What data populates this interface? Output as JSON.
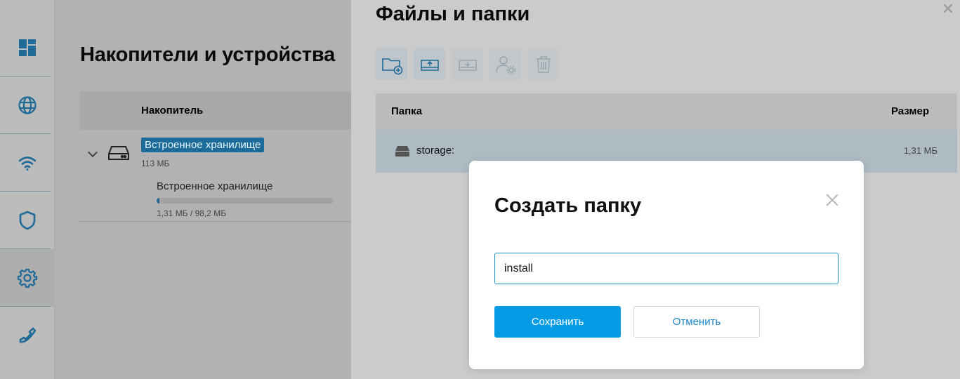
{
  "sidebar": {
    "items": [
      {
        "name": "dashboard",
        "icon": "dashboard-icon"
      },
      {
        "name": "internet",
        "icon": "globe-icon"
      },
      {
        "name": "wifi",
        "icon": "wifi-icon"
      },
      {
        "name": "security",
        "icon": "shield-icon"
      },
      {
        "name": "settings",
        "icon": "gear-icon",
        "active": true
      },
      {
        "name": "phone",
        "icon": "phone-icon"
      }
    ],
    "icon_color": "#1f6a96"
  },
  "background_page": {
    "title": "Накопители и устройства",
    "table_header": "Накопитель",
    "storage": {
      "name": "Встроенное хранилище",
      "size": "113 МБ",
      "partition_name": "Встроенное хранилище",
      "usage_text": "1,31 МБ / 98,2 МБ",
      "usage_fraction": 0.0133
    }
  },
  "file_panel": {
    "title": "Файлы и папки",
    "toolbar": [
      {
        "icon": "new-folder-icon",
        "enabled": true
      },
      {
        "icon": "upload-icon",
        "enabled": true
      },
      {
        "icon": "download-icon",
        "enabled": false
      },
      {
        "icon": "user-settings-icon",
        "enabled": false
      },
      {
        "icon": "trash-icon",
        "enabled": false
      }
    ],
    "columns": {
      "folder": "Папка",
      "size": "Размер"
    },
    "rows": [
      {
        "name": "storage:",
        "size": "1,31 МБ"
      }
    ]
  },
  "modal": {
    "title": "Создать папку",
    "input_value": "install",
    "save_label": "Сохранить",
    "cancel_label": "Отменить"
  },
  "colors": {
    "accent": "#049be5",
    "accent_text": "#1d86c6"
  }
}
